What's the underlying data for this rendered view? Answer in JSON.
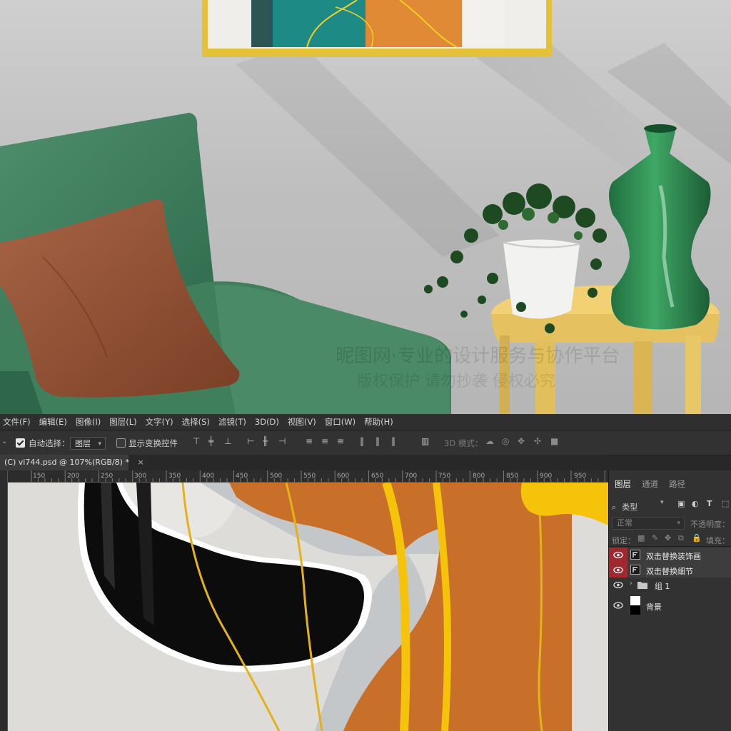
{
  "colors": {
    "ui_dark": "#282828",
    "panel": "#323232",
    "visibility_highlight": "#a0282e",
    "canvas_orange": "#c8702a",
    "canvas_gold": "#f2c20a"
  },
  "watermark": {
    "line1": "昵图网·专业的设计服务与协作平台",
    "line2": "版权保护 请勿抄袭 侵权必究"
  },
  "menubar": {
    "items": [
      "文件(F)",
      "编辑(E)",
      "图像(I)",
      "图层(L)",
      "文字(Y)",
      "选择(S)",
      "滤镜(T)",
      "3D(D)",
      "视图(V)",
      "窗口(W)",
      "帮助(H)"
    ]
  },
  "options": {
    "auto_select_label": "自动选择：",
    "auto_select_checked": true,
    "target_value": "图层",
    "show_transform_label": "显示变换控件",
    "show_transform_checked": false,
    "mode_3d_label": "3D 模式："
  },
  "document": {
    "tab_title": "(C) vi744.psd @ 107%(RGB/8) *",
    "close_glyph": "×"
  },
  "ruler": {
    "h_ticks": [
      "150",
      "200",
      "250",
      "300",
      "350",
      "400",
      "450",
      "500",
      "550",
      "600",
      "650",
      "700",
      "750",
      "800",
      "850",
      "900",
      "950"
    ]
  },
  "layers_panel": {
    "tabs": [
      "图层",
      "通道",
      "路径"
    ],
    "active_tab": "图层",
    "filter_value": "类型",
    "blend_mode": "正常",
    "opacity_label": "不透明度：",
    "lock_label": "锁定：",
    "fill_label": "填充：",
    "layers": [
      {
        "name": "双击替换装饰画",
        "type": "smart-object",
        "visible": true,
        "highlighted": true
      },
      {
        "name": "双击替换细节",
        "type": "smart-object",
        "visible": true,
        "highlighted": true
      },
      {
        "name": "组 1",
        "type": "group",
        "visible": true,
        "highlighted": false
      },
      {
        "name": "背景",
        "type": "background",
        "visible": true,
        "highlighted": false
      }
    ]
  }
}
